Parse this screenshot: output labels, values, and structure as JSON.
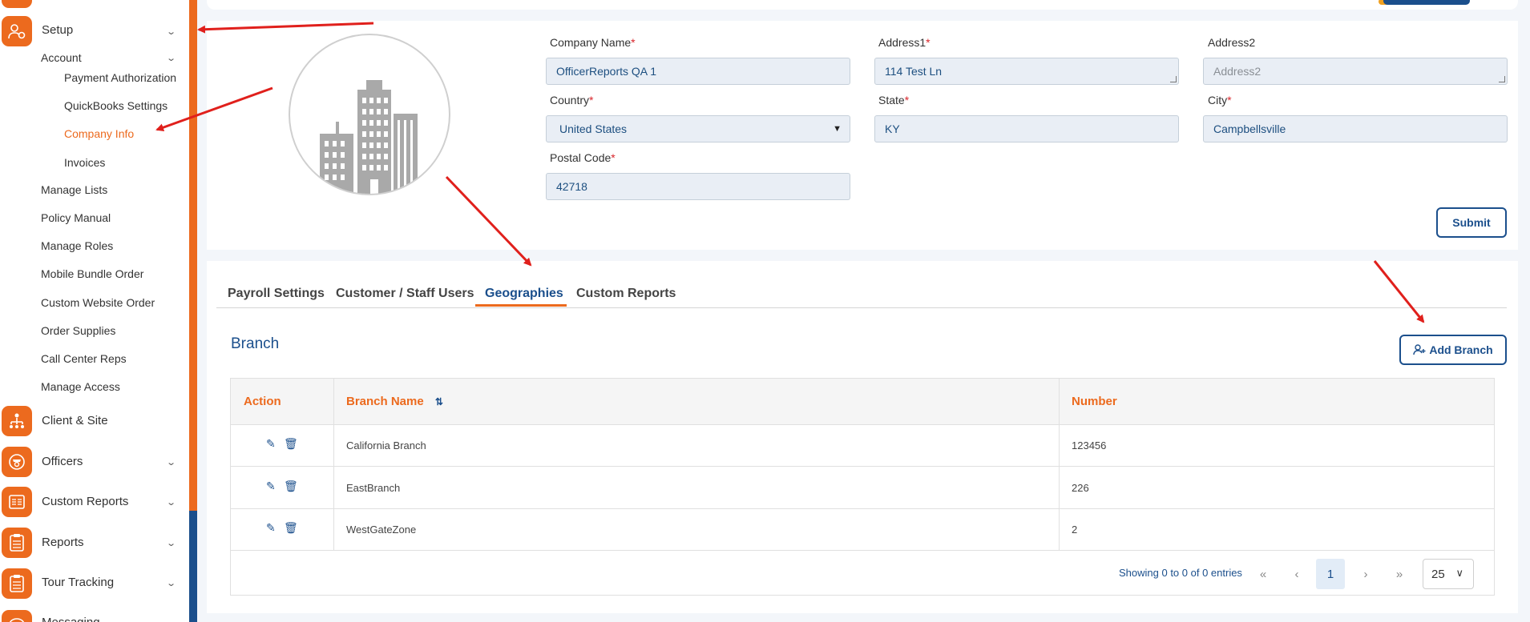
{
  "sidebar": {
    "setup_label": "Setup",
    "account_label": "Account",
    "account_items": [
      {
        "label": "Payment Authorization"
      },
      {
        "label": "QuickBooks Settings"
      },
      {
        "label": "Company Info"
      },
      {
        "label": "Invoices"
      }
    ],
    "setup_items": [
      {
        "label": "Manage Lists"
      },
      {
        "label": "Policy Manual"
      },
      {
        "label": "Manage Roles"
      },
      {
        "label": "Mobile Bundle Order"
      },
      {
        "label": "Custom Website Order"
      },
      {
        "label": "Order Supplies"
      },
      {
        "label": "Call Center Reps"
      },
      {
        "label": "Manage Access"
      }
    ],
    "modules": [
      {
        "label": "Client & Site"
      },
      {
        "label": "Officers"
      },
      {
        "label": "Custom Reports"
      },
      {
        "label": "Reports"
      },
      {
        "label": "Tour Tracking"
      },
      {
        "label": "Messaging"
      }
    ],
    "active_item": "Company Info"
  },
  "company_form": {
    "company_name": {
      "label": "Company Name",
      "value": "OfficerReports QA 1"
    },
    "address1": {
      "label": "Address1",
      "value": "114 Test Ln"
    },
    "address2": {
      "label": "Address2",
      "placeholder": "Address2"
    },
    "country": {
      "label": "Country",
      "value": "United States"
    },
    "state": {
      "label": "State",
      "value": "KY"
    },
    "city": {
      "label": "City",
      "value": "Campbellsville"
    },
    "postal_code": {
      "label": "Postal Code",
      "value": "42718"
    },
    "required_mark": "*",
    "submit_label": "Submit"
  },
  "tabs": [
    {
      "label": "Payroll Settings"
    },
    {
      "label": "Customer / Staff Users"
    },
    {
      "label": "Geographies",
      "active": true
    },
    {
      "label": "Custom Reports"
    }
  ],
  "branch": {
    "title": "Branch",
    "add_label": "Add Branch",
    "columns": {
      "action": "Action",
      "name": "Branch Name",
      "number": "Number"
    },
    "rows": [
      {
        "name": "California Branch",
        "number": "123456"
      },
      {
        "name": "EastBranch",
        "number": "226"
      },
      {
        "name": "WestGateZone",
        "number": "2"
      }
    ],
    "pagination": {
      "summary": "Showing 0 to 0 of 0 entries",
      "current_page": "1",
      "page_size": "25"
    }
  },
  "colors": {
    "accent": "#ec6a1e",
    "primary": "#1b4f8c",
    "annotation_arrow": "#e0201c"
  },
  "icons": [
    "setup-icon",
    "client-site-icon",
    "officers-icon",
    "custom-reports-icon",
    "reports-icon",
    "tour-tracking-icon",
    "messaging-icon",
    "building-icon",
    "edit-icon",
    "trash-icon",
    "add-user-icon",
    "sort-icon"
  ]
}
